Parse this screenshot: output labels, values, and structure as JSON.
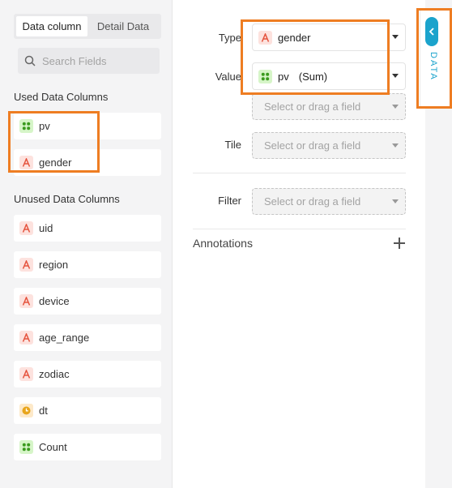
{
  "left_panel": {
    "tabs": [
      {
        "label": "Data column",
        "active": true
      },
      {
        "label": "Detail Data",
        "active": false
      }
    ],
    "search": {
      "placeholder": "Search Fields",
      "value": ""
    },
    "used_title": "Used Data Columns",
    "used_fields": [
      {
        "name": "pv",
        "type": "number"
      },
      {
        "name": "gender",
        "type": "text"
      }
    ],
    "unused_title": "Unused Data Columns",
    "unused_fields": [
      {
        "name": "uid",
        "type": "text"
      },
      {
        "name": "region",
        "type": "text"
      },
      {
        "name": "device",
        "type": "text"
      },
      {
        "name": "age_range",
        "type": "text"
      },
      {
        "name": "zodiac",
        "type": "text"
      },
      {
        "name": "dt",
        "type": "date"
      },
      {
        "name": "Count",
        "type": "number"
      }
    ]
  },
  "config": {
    "type_label": "Type",
    "type_value": "gender",
    "value_label": "Value",
    "value_field": "pv",
    "value_agg": "(Sum)",
    "drop_placeholder": "Select or drag a field",
    "tile_label": "Tile",
    "filter_label": "Filter",
    "annotations_label": "Annotations"
  },
  "rail": {
    "label": "DATA"
  },
  "colors": {
    "accent": "#1ba3cc",
    "highlight": "#ee7d22",
    "text_badge": "#fde2de",
    "number_badge": "#d6f5c8",
    "date_badge": "#fde9c9"
  }
}
